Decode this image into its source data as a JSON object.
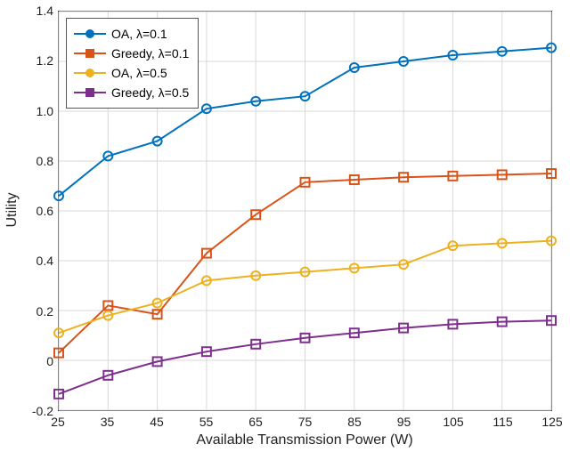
{
  "chart_data": {
    "type": "line",
    "title": "",
    "xlabel": "Available Transmission Power (W)",
    "ylabel": "Utility",
    "xlim": [
      25,
      125
    ],
    "ylim": [
      -0.2,
      1.4
    ],
    "xticks": [
      25,
      35,
      45,
      55,
      65,
      75,
      85,
      95,
      105,
      115,
      125
    ],
    "yticks": [
      -0.2,
      0.0,
      0.2,
      0.4,
      0.6,
      0.8,
      1.0,
      1.2,
      1.4
    ],
    "x": [
      25,
      35,
      45,
      55,
      65,
      75,
      85,
      95,
      105,
      115,
      125
    ],
    "series": [
      {
        "name": "OA, λ=0.1",
        "color": "#0072BD",
        "marker": "circle",
        "values": [
          0.66,
          0.82,
          0.88,
          1.01,
          1.04,
          1.06,
          1.175,
          1.2,
          1.225,
          1.24,
          1.255
        ]
      },
      {
        "name": "Greedy, λ=0.1",
        "color": "#D95319",
        "marker": "square",
        "values": [
          0.03,
          0.22,
          0.185,
          0.43,
          0.585,
          0.715,
          0.725,
          0.735,
          0.74,
          0.745,
          0.75
        ]
      },
      {
        "name": "OA, λ=0.5",
        "color": "#EDB120",
        "marker": "circle",
        "values": [
          0.11,
          0.18,
          0.23,
          0.32,
          0.34,
          0.355,
          0.37,
          0.385,
          0.46,
          0.47,
          0.48
        ]
      },
      {
        "name": "Greedy, λ=0.5",
        "color": "#7E2F8E",
        "marker": "square",
        "values": [
          -0.135,
          -0.06,
          -0.005,
          0.035,
          0.065,
          0.09,
          0.11,
          0.13,
          0.145,
          0.155,
          0.16
        ]
      }
    ],
    "grid": true,
    "legend_position": "upper-left"
  }
}
